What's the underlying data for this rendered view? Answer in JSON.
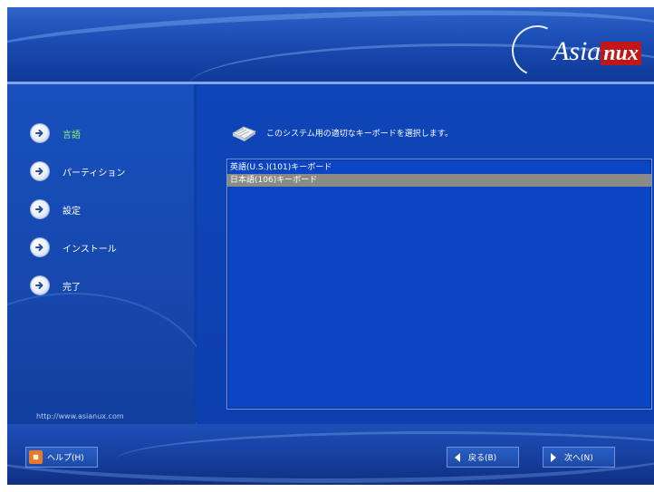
{
  "header": {
    "logo_text": "Asia",
    "logo_accent": "nux"
  },
  "sidebar": {
    "steps": [
      {
        "label": "言語",
        "active": true
      },
      {
        "label": "パーティション",
        "active": false
      },
      {
        "label": "設定",
        "active": false
      },
      {
        "label": "インストール",
        "active": false
      },
      {
        "label": "完了",
        "active": false
      }
    ],
    "url": "http://www.asianux.com"
  },
  "main": {
    "instruction": "このシステム用の適切なキーボードを選択します。",
    "keyboards": [
      {
        "label": "英語(U.S.)(101)キーボード",
        "selected": false
      },
      {
        "label": "日本語(106)キーボード",
        "selected": true
      }
    ]
  },
  "footer": {
    "help_label": "ヘルプ(H)",
    "back_label": "戻る(B)",
    "next_label": "次へ(N)"
  },
  "colors": {
    "accent_active": "#8ef07a",
    "selection": "#8a8a86",
    "background": "#0d3fa6",
    "logo_red": "#c0181a"
  },
  "icons": {
    "step": "arrow-right-circle-icon",
    "keyboard": "keyboard-icon",
    "help": "help-icon",
    "back": "back-arrow-icon",
    "next": "next-arrow-icon"
  }
}
